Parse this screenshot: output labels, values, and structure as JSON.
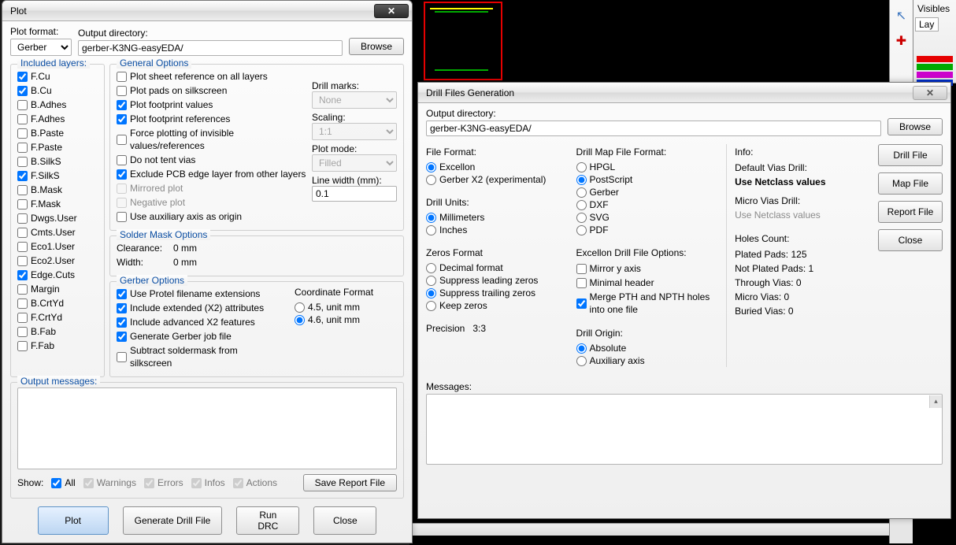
{
  "rightPanel": {
    "title": "Visibles",
    "tab": "Lay"
  },
  "plot": {
    "title": "Plot",
    "closeGlyph": "✕",
    "plotFormatLabel": "Plot format:",
    "plotFormat": "Gerber",
    "outputDirLabel": "Output directory:",
    "outputDir": "gerber-K3NG-easyEDA/",
    "browse": "Browse",
    "includedLayersLabel": "Included layers:",
    "layers": [
      {
        "name": "F.Cu",
        "on": true
      },
      {
        "name": "B.Cu",
        "on": true
      },
      {
        "name": "B.Adhes",
        "on": false
      },
      {
        "name": "F.Adhes",
        "on": false
      },
      {
        "name": "B.Paste",
        "on": false
      },
      {
        "name": "F.Paste",
        "on": false
      },
      {
        "name": "B.SilkS",
        "on": false
      },
      {
        "name": "F.SilkS",
        "on": true
      },
      {
        "name": "B.Mask",
        "on": false
      },
      {
        "name": "F.Mask",
        "on": false
      },
      {
        "name": "Dwgs.User",
        "on": false
      },
      {
        "name": "Cmts.User",
        "on": false
      },
      {
        "name": "Eco1.User",
        "on": false
      },
      {
        "name": "Eco2.User",
        "on": false
      },
      {
        "name": "Edge.Cuts",
        "on": true
      },
      {
        "name": "Margin",
        "on": false
      },
      {
        "name": "B.CrtYd",
        "on": false
      },
      {
        "name": "F.CrtYd",
        "on": false
      },
      {
        "name": "B.Fab",
        "on": false
      },
      {
        "name": "F.Fab",
        "on": false
      }
    ],
    "generalOptionsLabel": "General Options",
    "general": [
      {
        "label": "Plot sheet reference on all layers",
        "on": false,
        "disabled": false
      },
      {
        "label": "Plot pads on silkscreen",
        "on": false,
        "disabled": false
      },
      {
        "label": "Plot footprint values",
        "on": true,
        "disabled": false
      },
      {
        "label": "Plot footprint references",
        "on": true,
        "disabled": false
      },
      {
        "label": "Force plotting of invisible values/references",
        "on": false,
        "disabled": false
      },
      {
        "label": "Do not tent vias",
        "on": false,
        "disabled": false
      },
      {
        "label": "Exclude PCB edge layer from other layers",
        "on": true,
        "disabled": false
      },
      {
        "label": "Mirrored plot",
        "on": false,
        "disabled": true
      },
      {
        "label": "Negative plot",
        "on": false,
        "disabled": true
      },
      {
        "label": "Use auxiliary axis as origin",
        "on": false,
        "disabled": false
      }
    ],
    "drillMarksLabel": "Drill marks:",
    "drillMarks": "None",
    "scalingLabel": "Scaling:",
    "scaling": "1:1",
    "plotModeLabel": "Plot mode:",
    "plotMode": "Filled",
    "lineWidthLabel": "Line width (mm):",
    "lineWidth": "0.1",
    "solderMaskLabel": "Solder Mask Options",
    "solderClearanceK": "Clearance:",
    "solderClearanceV": "0 mm",
    "solderWidthK": "Width:",
    "solderWidthV": "0 mm",
    "gerberOptionsLabel": "Gerber Options",
    "gerber": [
      {
        "label": "Use Protel filename extensions",
        "on": true
      },
      {
        "label": "Include extended (X2) attributes",
        "on": true
      },
      {
        "label": "Include advanced X2 features",
        "on": true
      },
      {
        "label": "Generate Gerber job file",
        "on": true
      },
      {
        "label": "Subtract soldermask from silkscreen",
        "on": false
      }
    ],
    "coordFormatLabel": "Coordinate Format",
    "coord": [
      {
        "label": "4.5, unit mm",
        "on": false
      },
      {
        "label": "4.6, unit mm",
        "on": true
      }
    ],
    "outputMessagesLabel": "Output messages:",
    "showLabel": "Show:",
    "showAll": "All",
    "showWarnings": "Warnings",
    "showErrors": "Errors",
    "showInfos": "Infos",
    "showActions": "Actions",
    "saveReport": "Save Report File",
    "btnPlot": "Plot",
    "btnGenDrill": "Generate Drill File",
    "btnRunDRC": "Run DRC",
    "btnClose": "Close"
  },
  "drill": {
    "title": "Drill Files Generation",
    "outputDirLabel": "Output directory:",
    "outputDir": "gerber-K3NG-easyEDA/",
    "browse": "Browse",
    "fileFormatLabel": "File Format:",
    "fileFormat": [
      {
        "label": "Excellon",
        "on": true
      },
      {
        "label": "Gerber X2 (experimental)",
        "on": false
      }
    ],
    "drillUnitsLabel": "Drill Units:",
    "drillUnits": [
      {
        "label": "Millimeters",
        "on": true
      },
      {
        "label": "Inches",
        "on": false
      }
    ],
    "zerosLabel": "Zeros Format",
    "zeros": [
      {
        "label": "Decimal format",
        "on": false
      },
      {
        "label": "Suppress leading zeros",
        "on": false
      },
      {
        "label": "Suppress trailing zeros",
        "on": true
      },
      {
        "label": "Keep zeros",
        "on": false
      }
    ],
    "precisionLabel": "Precision",
    "precisionVal": "3:3",
    "mapFormatLabel": "Drill Map File Format:",
    "mapFormat": [
      {
        "label": "HPGL",
        "on": false
      },
      {
        "label": "PostScript",
        "on": true
      },
      {
        "label": "Gerber",
        "on": false
      },
      {
        "label": "DXF",
        "on": false
      },
      {
        "label": "SVG",
        "on": false
      },
      {
        "label": "PDF",
        "on": false
      }
    ],
    "excellonOptsLabel": "Excellon Drill File Options:",
    "excellonOpts": [
      {
        "label": "Mirror y axis",
        "on": false
      },
      {
        "label": "Minimal header",
        "on": false
      },
      {
        "label": "Merge PTH and NPTH holes into one file",
        "on": true
      }
    ],
    "drillOriginLabel": "Drill Origin:",
    "drillOrigin": [
      {
        "label": "Absolute",
        "on": true
      },
      {
        "label": "Auxiliary axis",
        "on": false
      }
    ],
    "infoLabel": "Info:",
    "defaultViasK": "Default Vias Drill:",
    "defaultViasV": "Use Netclass values",
    "microViasK": "Micro Vias Drill:",
    "microViasV": "Use Netclass values",
    "holesCountLabel": "Holes Count:",
    "holes": [
      "Plated Pads: 125",
      "Not Plated Pads: 1",
      "Through Vias: 0",
      "Micro Vias: 0",
      "Buried Vias: 0"
    ],
    "btnDrill": "Drill File",
    "btnMap": "Map File",
    "btnReport": "Report File",
    "btnClose": "Close",
    "messagesLabel": "Messages:"
  }
}
